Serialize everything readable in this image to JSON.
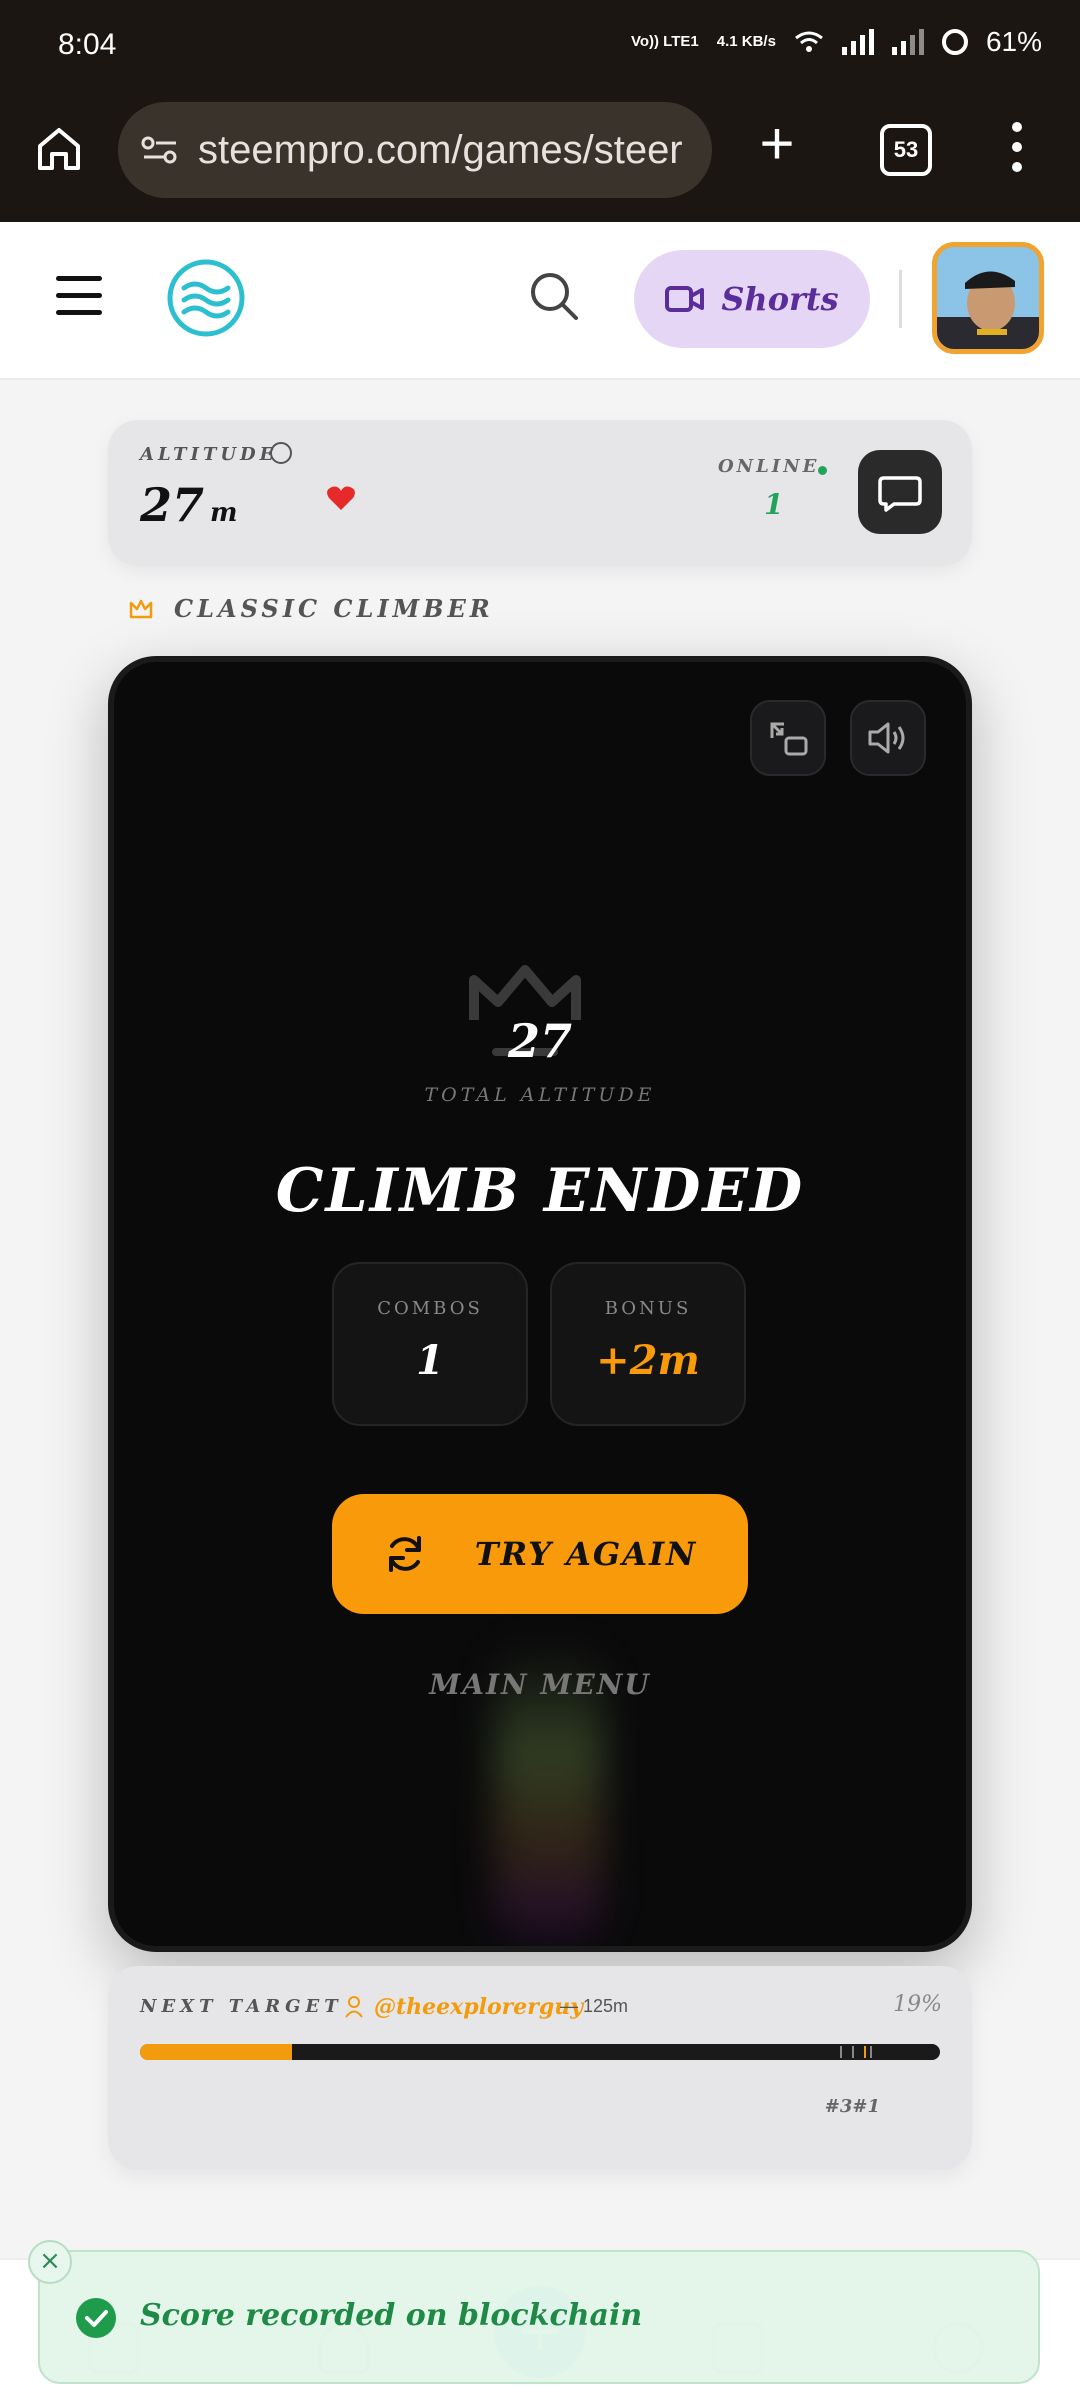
{
  "status_bar": {
    "time": "8:04",
    "network_top": "Vo)) LTE1",
    "speed": "4.1 KB/s",
    "battery": "61%"
  },
  "browser": {
    "url": "steempro.com/games/steer",
    "tab_count": "53"
  },
  "header": {
    "shorts_label": "Shorts"
  },
  "stats_bar": {
    "altitude_label": "ALTITUDE",
    "altitude_value": "27",
    "altitude_unit": "m",
    "online_label": "ONLINE",
    "online_count": "1"
  },
  "mode": {
    "label": "CLASSIC CLIMBER"
  },
  "game": {
    "total_value": "27",
    "total_label": "TOTAL ALTITUDE",
    "title": "CLIMB ENDED",
    "combos_label": "COMBOS",
    "combos_value": "1",
    "bonus_label": "BONUS",
    "bonus_value": "+2m",
    "try_again_label": "TRY AGAIN",
    "main_menu_label": "MAIN MENU"
  },
  "next_target": {
    "label": "NEXT TARGET",
    "user": "@theexplorerguy",
    "distance": "— 125m",
    "percent": "19%",
    "progress_fraction": 0.19,
    "rank": "#3#1"
  },
  "toast": {
    "message": "Score recorded on blockchain"
  },
  "colors": {
    "accent": "#f99a0a",
    "online": "#22a35a",
    "success": "#1f9b4c",
    "shorts_bg": "#e5d6f5"
  }
}
